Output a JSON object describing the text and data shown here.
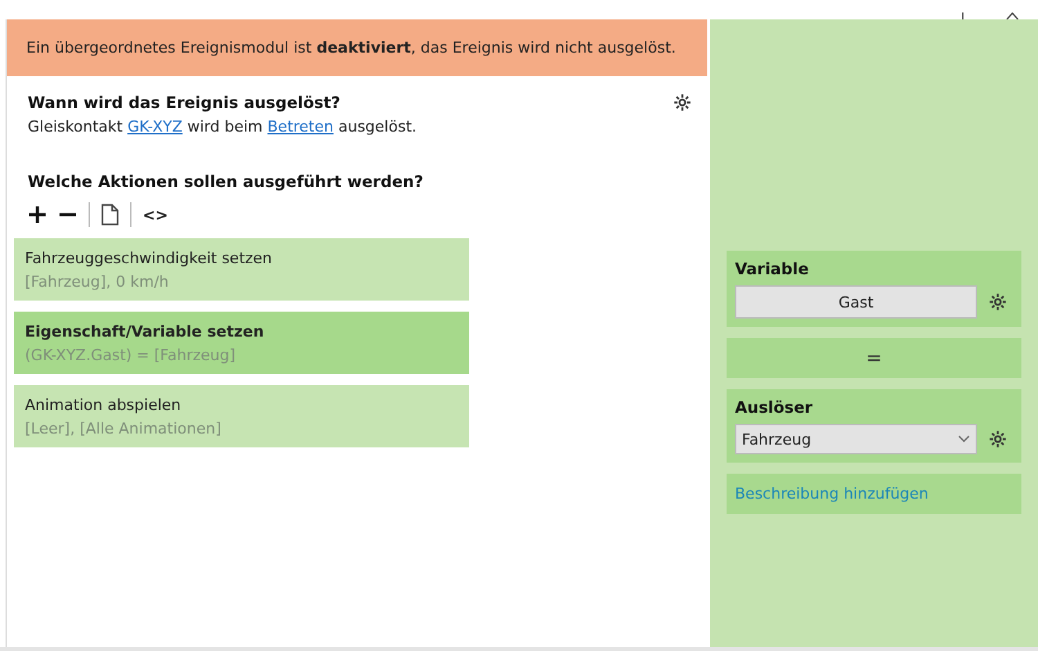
{
  "banner": {
    "text": "Ein übergeordnetes Ereignismodul ist **deaktiviert**, das Ereignis wird nicht ausgelöst."
  },
  "trigger": {
    "heading": "Wann wird das Ereignis ausgelöst?",
    "parts": [
      {
        "kind": "text",
        "text": "Gleiskontakt "
      },
      {
        "kind": "link",
        "text": "GK-XYZ"
      },
      {
        "kind": "text",
        "text": " wird beim "
      },
      {
        "kind": "link",
        "text": "Betreten"
      },
      {
        "kind": "text",
        "text": " ausgelöst."
      }
    ]
  },
  "actions": {
    "heading": "Welche Aktionen sollen ausgeführt werden?",
    "toolbar": [
      {
        "kind": "add"
      },
      {
        "kind": "remove"
      },
      {
        "kind": "separator"
      },
      {
        "kind": "copy"
      },
      {
        "kind": "separator"
      },
      {
        "kind": "code",
        "text": "<>"
      }
    ],
    "items": [
      {
        "title": "Fahrzeuggeschwindigkeit setzen",
        "detail": "[Fahrzeug], 0 km/h",
        "selected": false
      },
      {
        "title": "Eigenschaft/Variable setzen",
        "detail": "(GK-XYZ.Gast) = [Fahrzeug]",
        "selected": true
      },
      {
        "title": "Animation abspielen",
        "detail": "[Leer], [Alle Animationen]",
        "selected": false
      }
    ]
  },
  "properties": {
    "variable": {
      "label": "Variable",
      "value": "Gast"
    },
    "operator": "=",
    "trigger": {
      "label": "Auslöser",
      "value": "Fahrzeug"
    },
    "description_link": "Beschreibung hinzufügen"
  }
}
